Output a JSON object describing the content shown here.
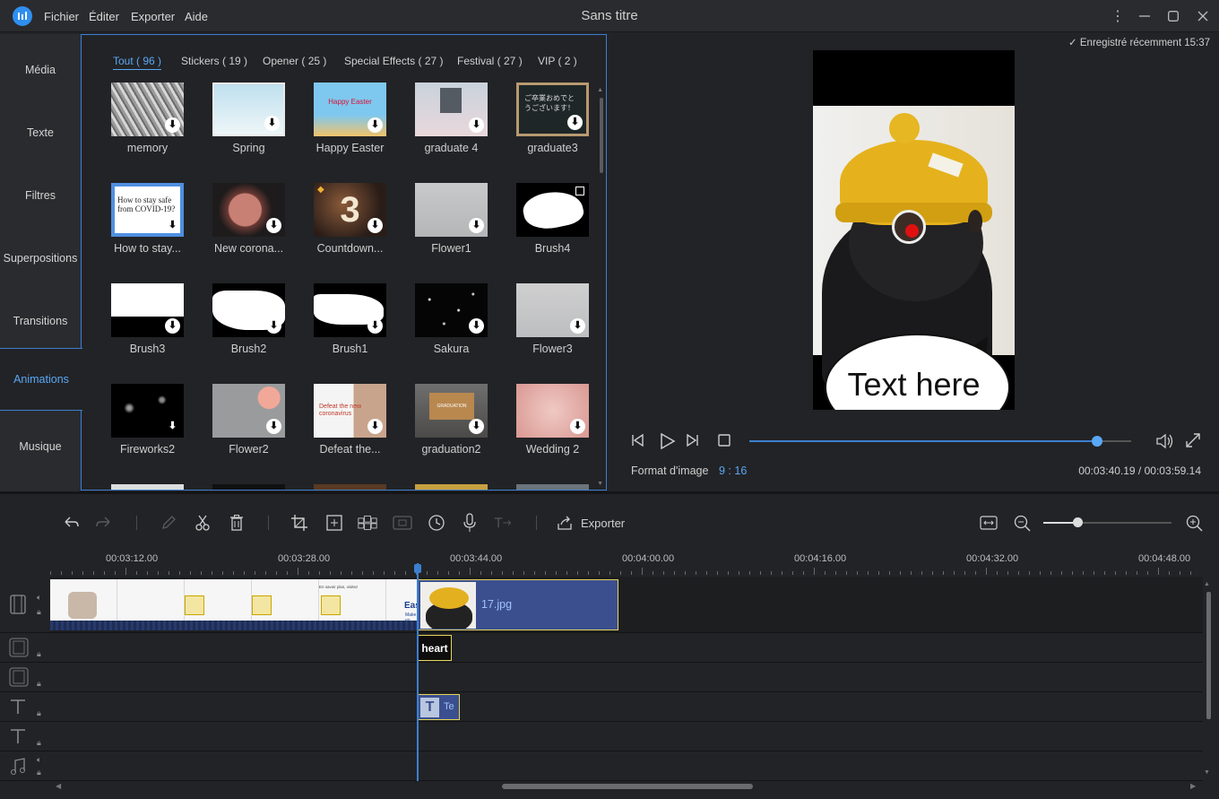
{
  "app": {
    "title": "Sans titre",
    "menu": [
      "Fichier",
      "Éditer",
      "Exporter",
      "Aide"
    ]
  },
  "sidebar": {
    "items": [
      {
        "label": "Média"
      },
      {
        "label": "Texte"
      },
      {
        "label": "Filtres"
      },
      {
        "label": "Superpositions"
      },
      {
        "label": "Transitions"
      },
      {
        "label": "Animations",
        "active": true
      },
      {
        "label": "Musique"
      }
    ]
  },
  "library": {
    "categories": [
      {
        "label": "Tout ( 96 )",
        "active": true
      },
      {
        "label": "Stickers ( 19 )"
      },
      {
        "label": "Opener ( 25 )"
      },
      {
        "label": "Special Effects ( 27 )"
      },
      {
        "label": "Festival ( 27 )"
      },
      {
        "label": "VIP ( 2 )"
      }
    ],
    "items": [
      {
        "name": "memory"
      },
      {
        "name": "Spring"
      },
      {
        "name": "Happy Easter"
      },
      {
        "name": "graduate 4"
      },
      {
        "name": "graduate3"
      },
      {
        "name": "How to stay..."
      },
      {
        "name": "New corona..."
      },
      {
        "name": "Countdown..."
      },
      {
        "name": "Flower1"
      },
      {
        "name": "Brush4"
      },
      {
        "name": "Brush3"
      },
      {
        "name": "Brush2"
      },
      {
        "name": "Brush1"
      },
      {
        "name": "Sakura"
      },
      {
        "name": "Flower3"
      },
      {
        "name": "Fireworks2"
      },
      {
        "name": "Flower2"
      },
      {
        "name": "Defeat the..."
      },
      {
        "name": "graduation2"
      },
      {
        "name": "Wedding 2"
      }
    ],
    "thumb_texts": {
      "happy_easter": "Happy Easter",
      "graduate3": "ご卒業おめでとうございます！",
      "covid": "How to stay safe from COVID-19?",
      "countdown": "3",
      "defeat": "Defeat the new coronavirus",
      "graduation2": "GRADUATION"
    }
  },
  "preview": {
    "saved": "Enregistré récemment 15:37",
    "bubble_text": "Text here",
    "format_label": "Format d'image",
    "format_value": "9 : 16",
    "timecode": "00:03:40.19 / 00:03:59.14",
    "progress": 0.92
  },
  "toolbar": {
    "export_label": "Exporter",
    "zoom_level": 0.27
  },
  "timeline": {
    "ruler_labels": [
      "00:03:12.00",
      "00:03:28.00",
      "00:03:44.00",
      "00:04:00.00",
      "00:04:16.00",
      "00:04:32.00",
      "00:04:48.00"
    ],
    "clips": {
      "image": "17.jpg",
      "animation": "heart",
      "text": "Te"
    },
    "strip_texts": [
      "En savoir plus, visitez",
      "Easy",
      "Make yo"
    ]
  }
}
